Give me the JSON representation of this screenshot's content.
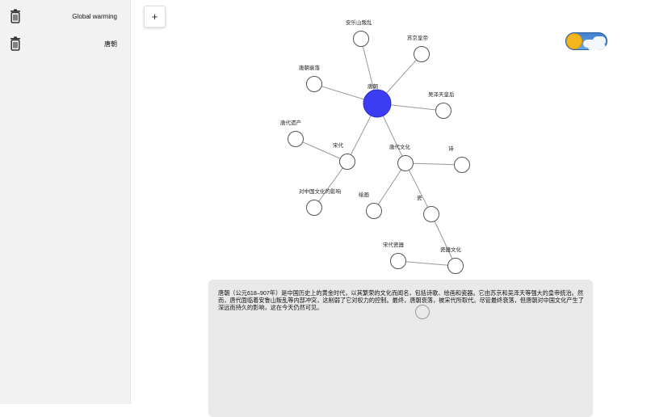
{
  "sidebar": {
    "items": [
      {
        "label": "Global warming",
        "icon": "trash-icon"
      },
      {
        "label": "唐朝",
        "icon": "trash-icon"
      }
    ]
  },
  "toolbar": {
    "add_label": "+"
  },
  "theme_toggle": {
    "state": "light",
    "icon": "sun-icon"
  },
  "graph": {
    "nodes": [
      {
        "id": "tang",
        "label": "唐朝",
        "highlight": true
      },
      {
        "id": "anshi",
        "label": "安乐山叛乱"
      },
      {
        "id": "suzong",
        "label": "苏京皇帝"
      },
      {
        "id": "shuaiLuo",
        "label": "唐朝衰落"
      },
      {
        "id": "wuze",
        "label": "吴泽天皇后"
      },
      {
        "id": "yichan",
        "label": "唐代遗产"
      },
      {
        "id": "song",
        "label": "宋代"
      },
      {
        "id": "wenhua",
        "label": "唐代文化"
      },
      {
        "id": "shi",
        "label": "诗"
      },
      {
        "id": "yingxiang",
        "label": "对中国文化的影响"
      },
      {
        "id": "huihua",
        "label": "绘画"
      },
      {
        "id": "ci",
        "label": "瓷"
      },
      {
        "id": "songci",
        "label": "宋代瓷器"
      },
      {
        "id": "ciwenhua",
        "label": "瓷器文化"
      }
    ],
    "edges": [
      [
        "tang",
        "anshi"
      ],
      [
        "tang",
        "suzong"
      ],
      [
        "tang",
        "shuaiLuo"
      ],
      [
        "tang",
        "wuze"
      ],
      [
        "tang",
        "song"
      ],
      [
        "tang",
        "wenhua"
      ],
      [
        "song",
        "yichan"
      ],
      [
        "song",
        "yingxiang"
      ],
      [
        "wenhua",
        "shi"
      ],
      [
        "wenhua",
        "huihua"
      ],
      [
        "wenhua",
        "ci"
      ],
      [
        "ci",
        "ciwenhua"
      ],
      [
        "ciwenhua",
        "songci"
      ]
    ],
    "colors": {
      "highlight": "#3c3cf0",
      "node_stroke": "#555555",
      "edge": "#9a9a9a"
    }
  },
  "panel": {
    "text": "唐朝（公元618–907年）是中国历史上的黄金时代，以其繁荣的文化而闻名，包括诗歌、绘画和瓷器。它由苏京和吴泽天等强大的皇帝统治。然而，唐代面临着安鲁山叛乱等内部冲突，这削弱了它对权力的控制。最终，唐朝衰落，被宋代所取代。尽管最终衰落，但唐朝对中国文化产生了深远而持久的影响，这在今天仍然可见。"
  }
}
